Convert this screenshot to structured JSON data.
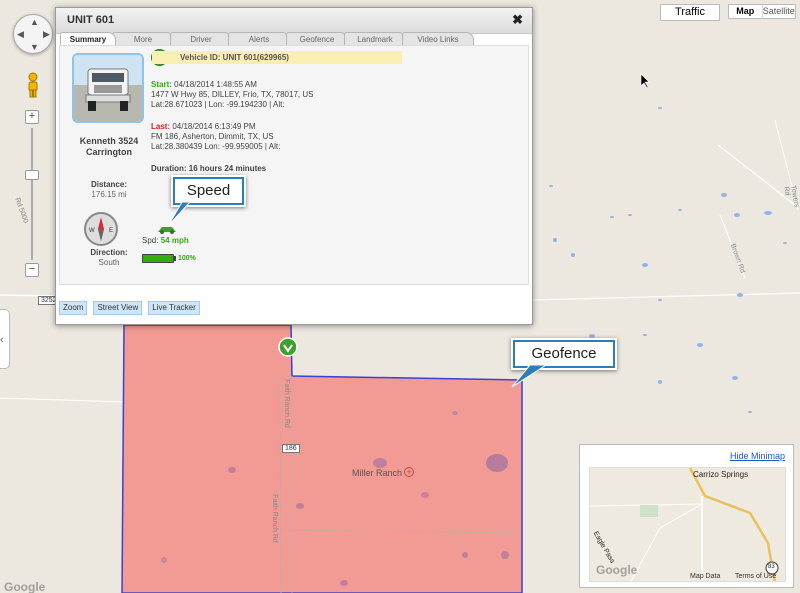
{
  "map": {
    "traffic_label": "Traffic",
    "map_type_map": "Map",
    "map_type_satellite": "Satellite",
    "road_labels": [
      "Rd 5000",
      "Towers Rd",
      "Brown Rd",
      "3252",
      "Faith Ranch Rd",
      "Faith Ranch Rd"
    ],
    "route_shield": "186",
    "place_label": "Miller Ranch",
    "google_logo": "Google",
    "geofence_color": "#f29a94",
    "geofence_border": "#3f3fd0"
  },
  "popup": {
    "title": "UNIT 601",
    "close": "✖",
    "tabs": [
      "Summary",
      "More",
      "Driver",
      "Alerts",
      "Geofence",
      "Landmark",
      "Video Links"
    ],
    "driver_name": "Kenneth 3524 Carrington",
    "distance_label": "Distance:",
    "distance_value": "176.15 mi",
    "direction_label": "Direction:",
    "direction_value": "South",
    "vehicle_id": "Vehicle ID: UNIT 601(629965)",
    "start_label": "Start:",
    "start_time": "04/18/2014 1:48:55 AM",
    "start_address": "1477 W Hwy 85, DILLEY, Frio, TX, 78017, US",
    "start_coords": "Lat:28.671023 | Lon: -99.194230  | Alt:",
    "last_label": "Last:",
    "last_time": "04/18/2014 6:13:49 PM",
    "last_address": "FM 186, Asherton, Dimmit, TX, US",
    "last_coords": "Lat:28.380439 Lon: -99.959005 | Alt:",
    "duration": "Duration: 16 hours 24 minutes",
    "speed_label": "Spd:",
    "speed_value": "54 mph",
    "battery": "100%",
    "footer_buttons": [
      "Zoom",
      "Street View",
      "Live Tracker"
    ]
  },
  "callouts": {
    "speed": "Speed",
    "geofence": "Geofence"
  },
  "minimap": {
    "hide_label": "Hide Minimap",
    "city": "Carrizo Springs",
    "road": "Eagle Pass",
    "shield": "83",
    "map_data": "Map Data",
    "terms": "Terms of Use",
    "google_logo": "Google"
  }
}
